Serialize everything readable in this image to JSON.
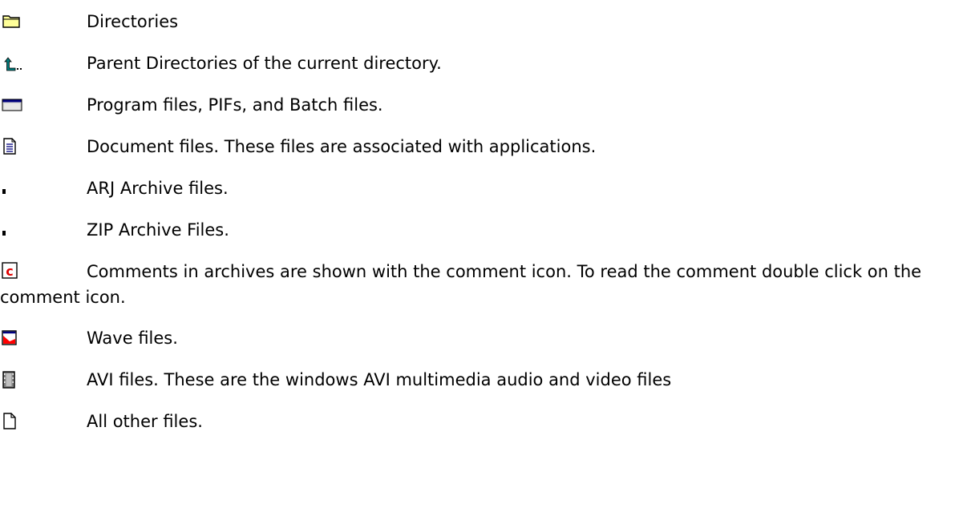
{
  "legend": {
    "entries": [
      {
        "icon": "folder-icon",
        "text": "Directories"
      },
      {
        "icon": "parent-directory-icon",
        "text": "Parent Directories of the current directory."
      },
      {
        "icon": "program-window-icon",
        "text": "Program files, PIFs, and Batch files."
      },
      {
        "icon": "document-icon",
        "text": "Document files. These files are associated with applications."
      },
      {
        "icon": "arj-archive-icon",
        "text": "ARJ Archive files."
      },
      {
        "icon": "zip-archive-icon",
        "text": "ZIP Archive Files."
      },
      {
        "icon": "comment-icon",
        "text": "Comments in archives are shown with the comment icon.   To read the comment double click on the comment icon."
      },
      {
        "icon": "wave-file-icon",
        "text": "Wave files."
      },
      {
        "icon": "avi-film-icon",
        "text": "AVI files. These are the windows AVI multimedia audio and video files"
      },
      {
        "icon": "blank-file-icon",
        "text": "All other files."
      }
    ]
  },
  "colors": {
    "folder_fill": "#ffff99",
    "comment_red": "#e00000",
    "parent_arrow": "#007b7b",
    "wave_red": "#ff0000",
    "window_title": "#000080"
  }
}
